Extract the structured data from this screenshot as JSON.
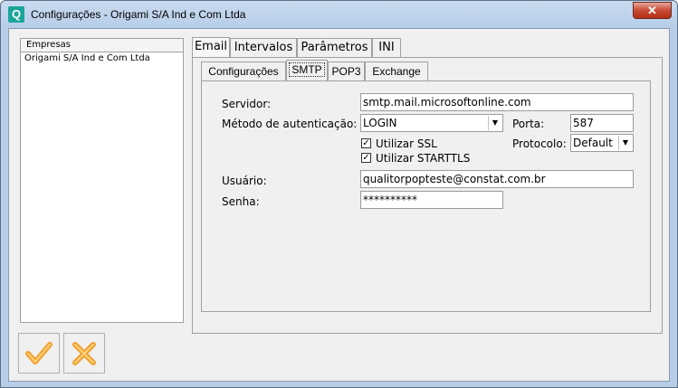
{
  "window": {
    "title": "Configurações - Origami S/A Ind e Com Ltda",
    "app_icon": "Q",
    "close_glyph": "✕"
  },
  "empresas": {
    "header": "Empresas",
    "items": [
      "Origami S/A Ind e Com Ltda"
    ]
  },
  "tabs": [
    "Email",
    "Intervalos",
    "Parâmetros",
    "INI"
  ],
  "active_tab": "Email",
  "subtabs": [
    "Configurações",
    "SMTP",
    "POP3",
    "Exchange"
  ],
  "active_subtab": "SMTP",
  "smtp": {
    "servidor_label": "Servidor:",
    "servidor_value": "smtp.mail.microsoftonline.com",
    "metodo_label": "Método de autenticação:",
    "metodo_value": "LOGIN",
    "porta_label": "Porta:",
    "porta_value": "587",
    "ssl_label": "Utilizar SSL",
    "ssl_checked": true,
    "starttls_label": "Utilizar STARTTLS",
    "starttls_checked": true,
    "protocolo_label": "Protocolo:",
    "protocolo_value": "Default",
    "usuario_label": "Usuário:",
    "usuario_value": "qualitorpopteste@constat.com.br",
    "senha_label": "Senha:",
    "senha_value": "**********"
  },
  "buttons": {
    "ok_icon": "checkmark-icon",
    "cancel_icon": "x-icon"
  },
  "colors": {
    "titlebar": "#b7cde8",
    "close": "#c74a35",
    "ok": "#f0a030",
    "cancel": "#f0a030"
  }
}
